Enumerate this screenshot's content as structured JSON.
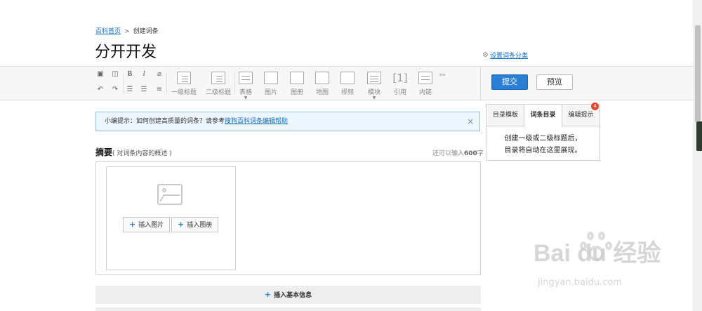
{
  "breadcrumb": {
    "home": "百科首页",
    "separator": ">",
    "current": "创建词条"
  },
  "page_title": "分开开发",
  "set_category": {
    "label": "设置词条分类"
  },
  "toolbar": {
    "small_tools": [
      "save-icon",
      "preview-doc-icon",
      "bold-icon",
      "italic-icon",
      "clear-format-icon",
      "undo-icon",
      "redo-icon",
      "ordered-list-icon",
      "unordered-list-icon",
      "align-icon"
    ],
    "tools": [
      {
        "name": "heading1",
        "label": "一级标题"
      },
      {
        "name": "heading2",
        "label": "二级标题"
      },
      {
        "name": "table",
        "label": "表格"
      },
      {
        "name": "image",
        "label": "图片"
      },
      {
        "name": "album",
        "label": "图册"
      },
      {
        "name": "map",
        "label": "地图"
      },
      {
        "name": "video",
        "label": "视频"
      },
      {
        "name": "module",
        "label": "模块"
      },
      {
        "name": "reference",
        "label": "引用",
        "glyph": "[1]"
      },
      {
        "name": "innerlink",
        "label": "内链"
      }
    ],
    "submit_label": "提交",
    "preview_label": "预览"
  },
  "tip": {
    "prefix": "小编提示：如何创建高质量的词条？请参考",
    "link": "搜狗百科词条编辑帮助",
    "close": "×"
  },
  "summary": {
    "title": "摘要",
    "hint": "( 对词条内容的概述 )",
    "count_prefix": "还可以输入",
    "count_value": "600",
    "count_suffix": "字",
    "insert_image": "插入图片",
    "insert_album": "插入图册"
  },
  "insert_basic_info": "插入基本信息",
  "side_panel": {
    "tabs": [
      "目录模板",
      "词条目录",
      "编辑提示"
    ],
    "active_tab": "词条目录",
    "badge": "4",
    "body_line1": "创建一级或二级标题后，",
    "body_line2": "目录将自动在这里展现。"
  },
  "watermark": {
    "main": "Bai du 经验",
    "sub": "jingyan.baidu.com"
  },
  "colors": {
    "link": "#136ec2",
    "primary": "#2a7fd4",
    "badge": "#e0452e"
  }
}
